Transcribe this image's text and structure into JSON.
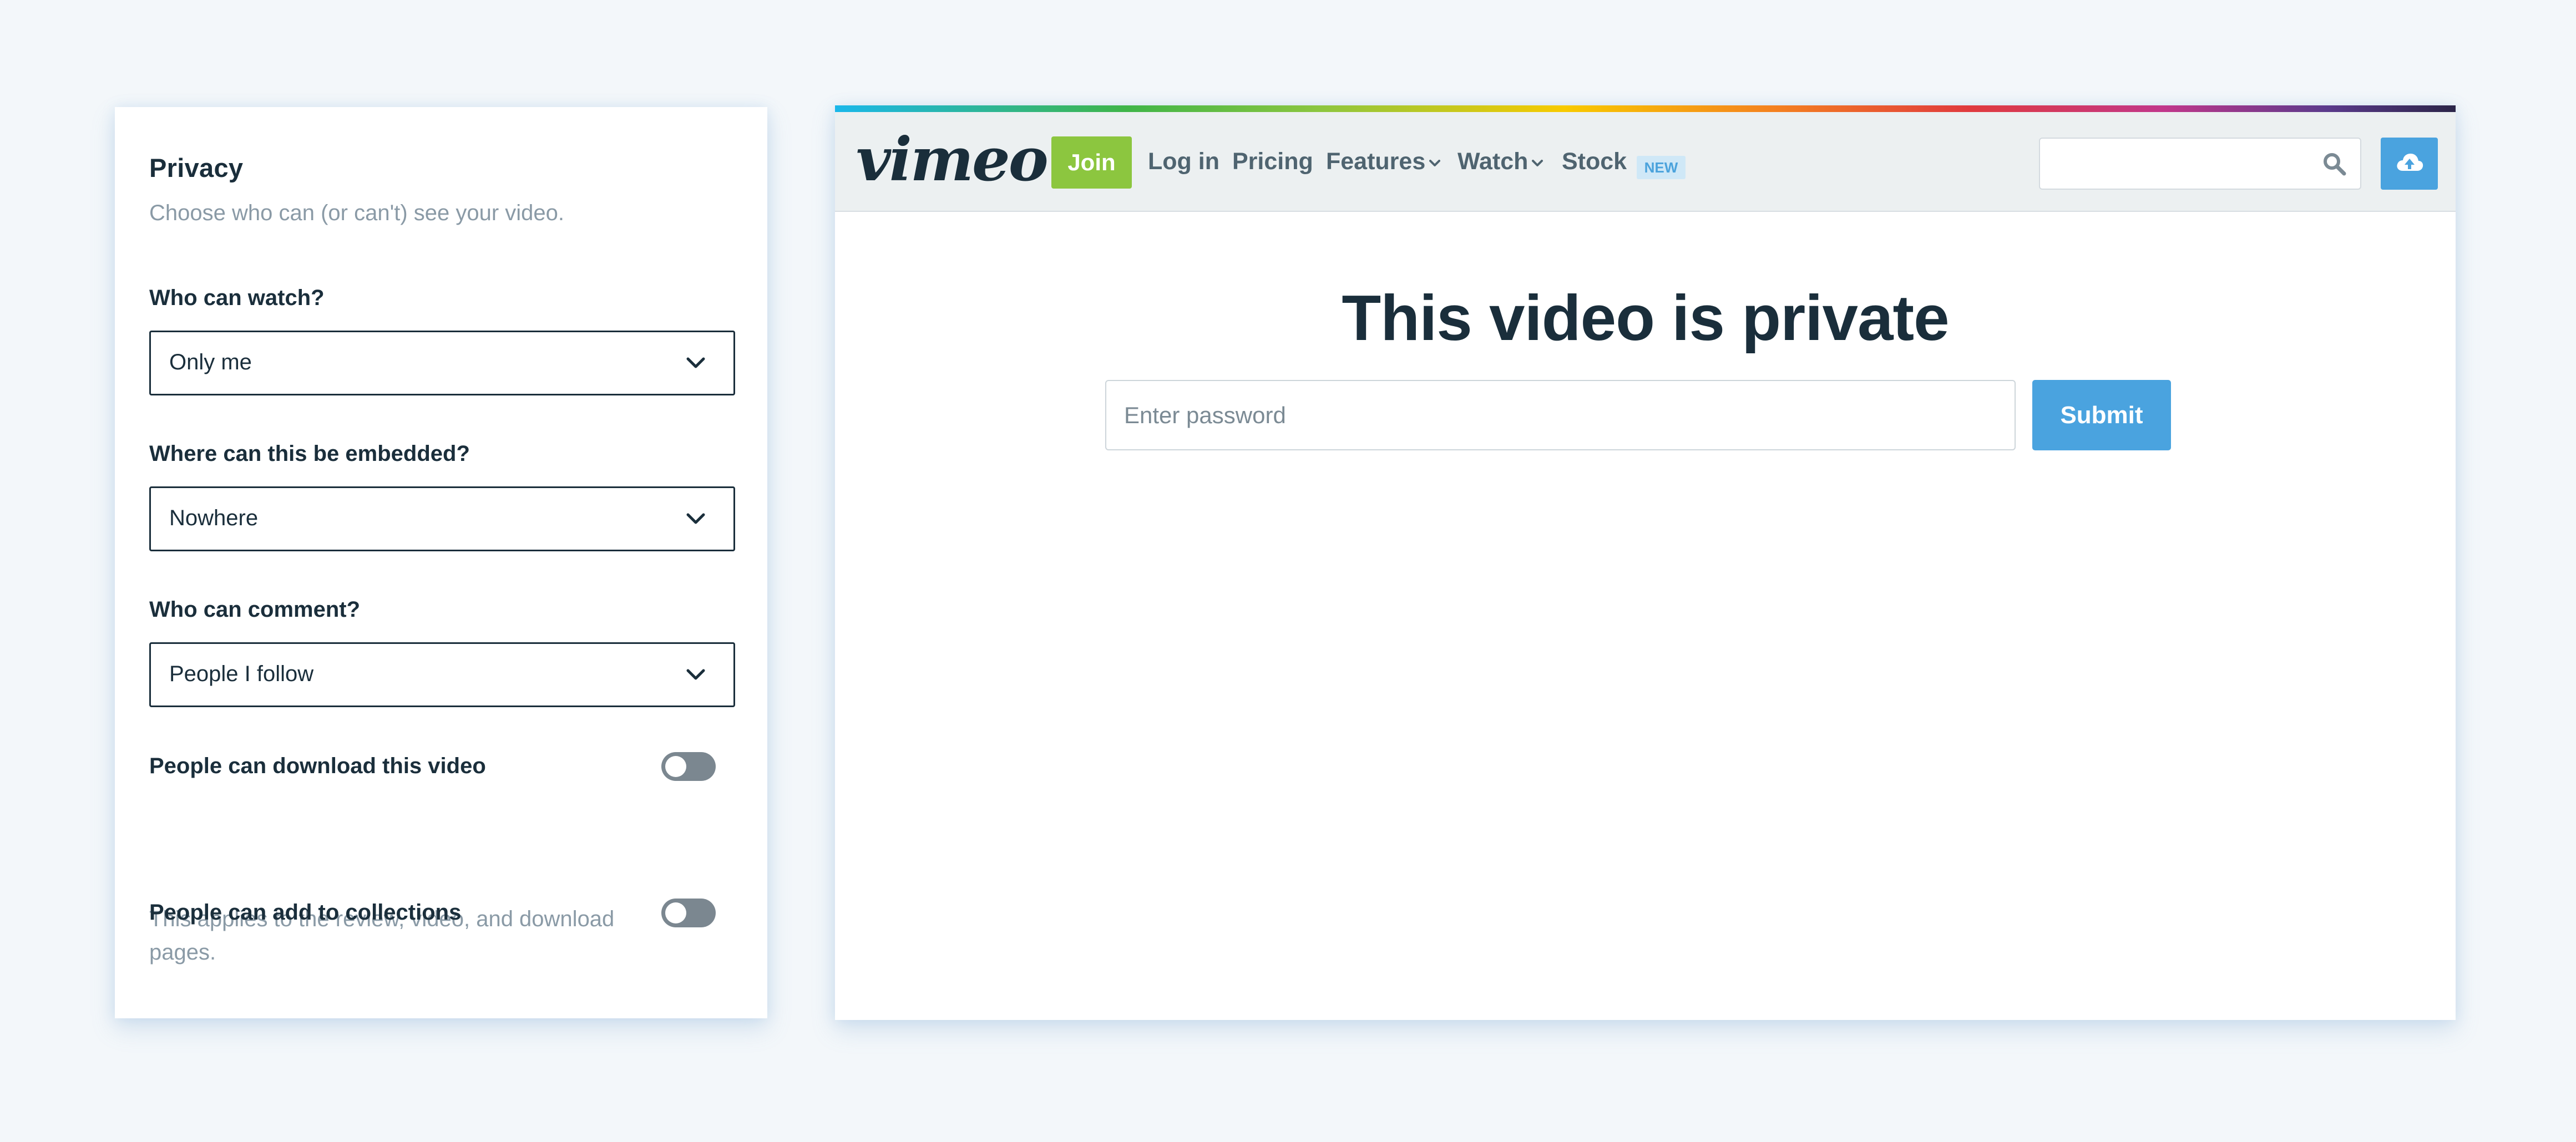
{
  "privacy": {
    "title": "Privacy",
    "subtitle": "Choose who can (or can't) see your video.",
    "watch_label": "Who can watch?",
    "watch_value": "Only me",
    "embed_label": "Where can this be embedded?",
    "embed_value": "Nowhere",
    "comment_label": "Who can comment?",
    "comment_value": "People I follow",
    "download_label": "People can download this video",
    "download_enabled": false,
    "download_note": "This applies to the review, video, and download pages.",
    "collections_label": "People can add to collections",
    "collections_enabled": false
  },
  "site": {
    "logo": "vimeo",
    "nav": {
      "join": "Join",
      "login": "Log in",
      "pricing": "Pricing",
      "features": "Features",
      "watch": "Watch",
      "stock": "Stock",
      "new_badge": "NEW"
    },
    "search_placeholder": "",
    "page_title": "This video is private",
    "password_placeholder": "Enter password",
    "submit": "Submit"
  },
  "colors": {
    "background": "#f3f7fa",
    "text_dark": "#1a2e3b",
    "muted": "#8a9aa6",
    "join_green": "#8cc63f",
    "accent_blue": "#4aa3df",
    "toggle_off": "#7b8790"
  },
  "icons": {
    "select_chevron": "chevron-down-icon",
    "search": "search-icon",
    "upload": "cloud-upload-icon"
  }
}
